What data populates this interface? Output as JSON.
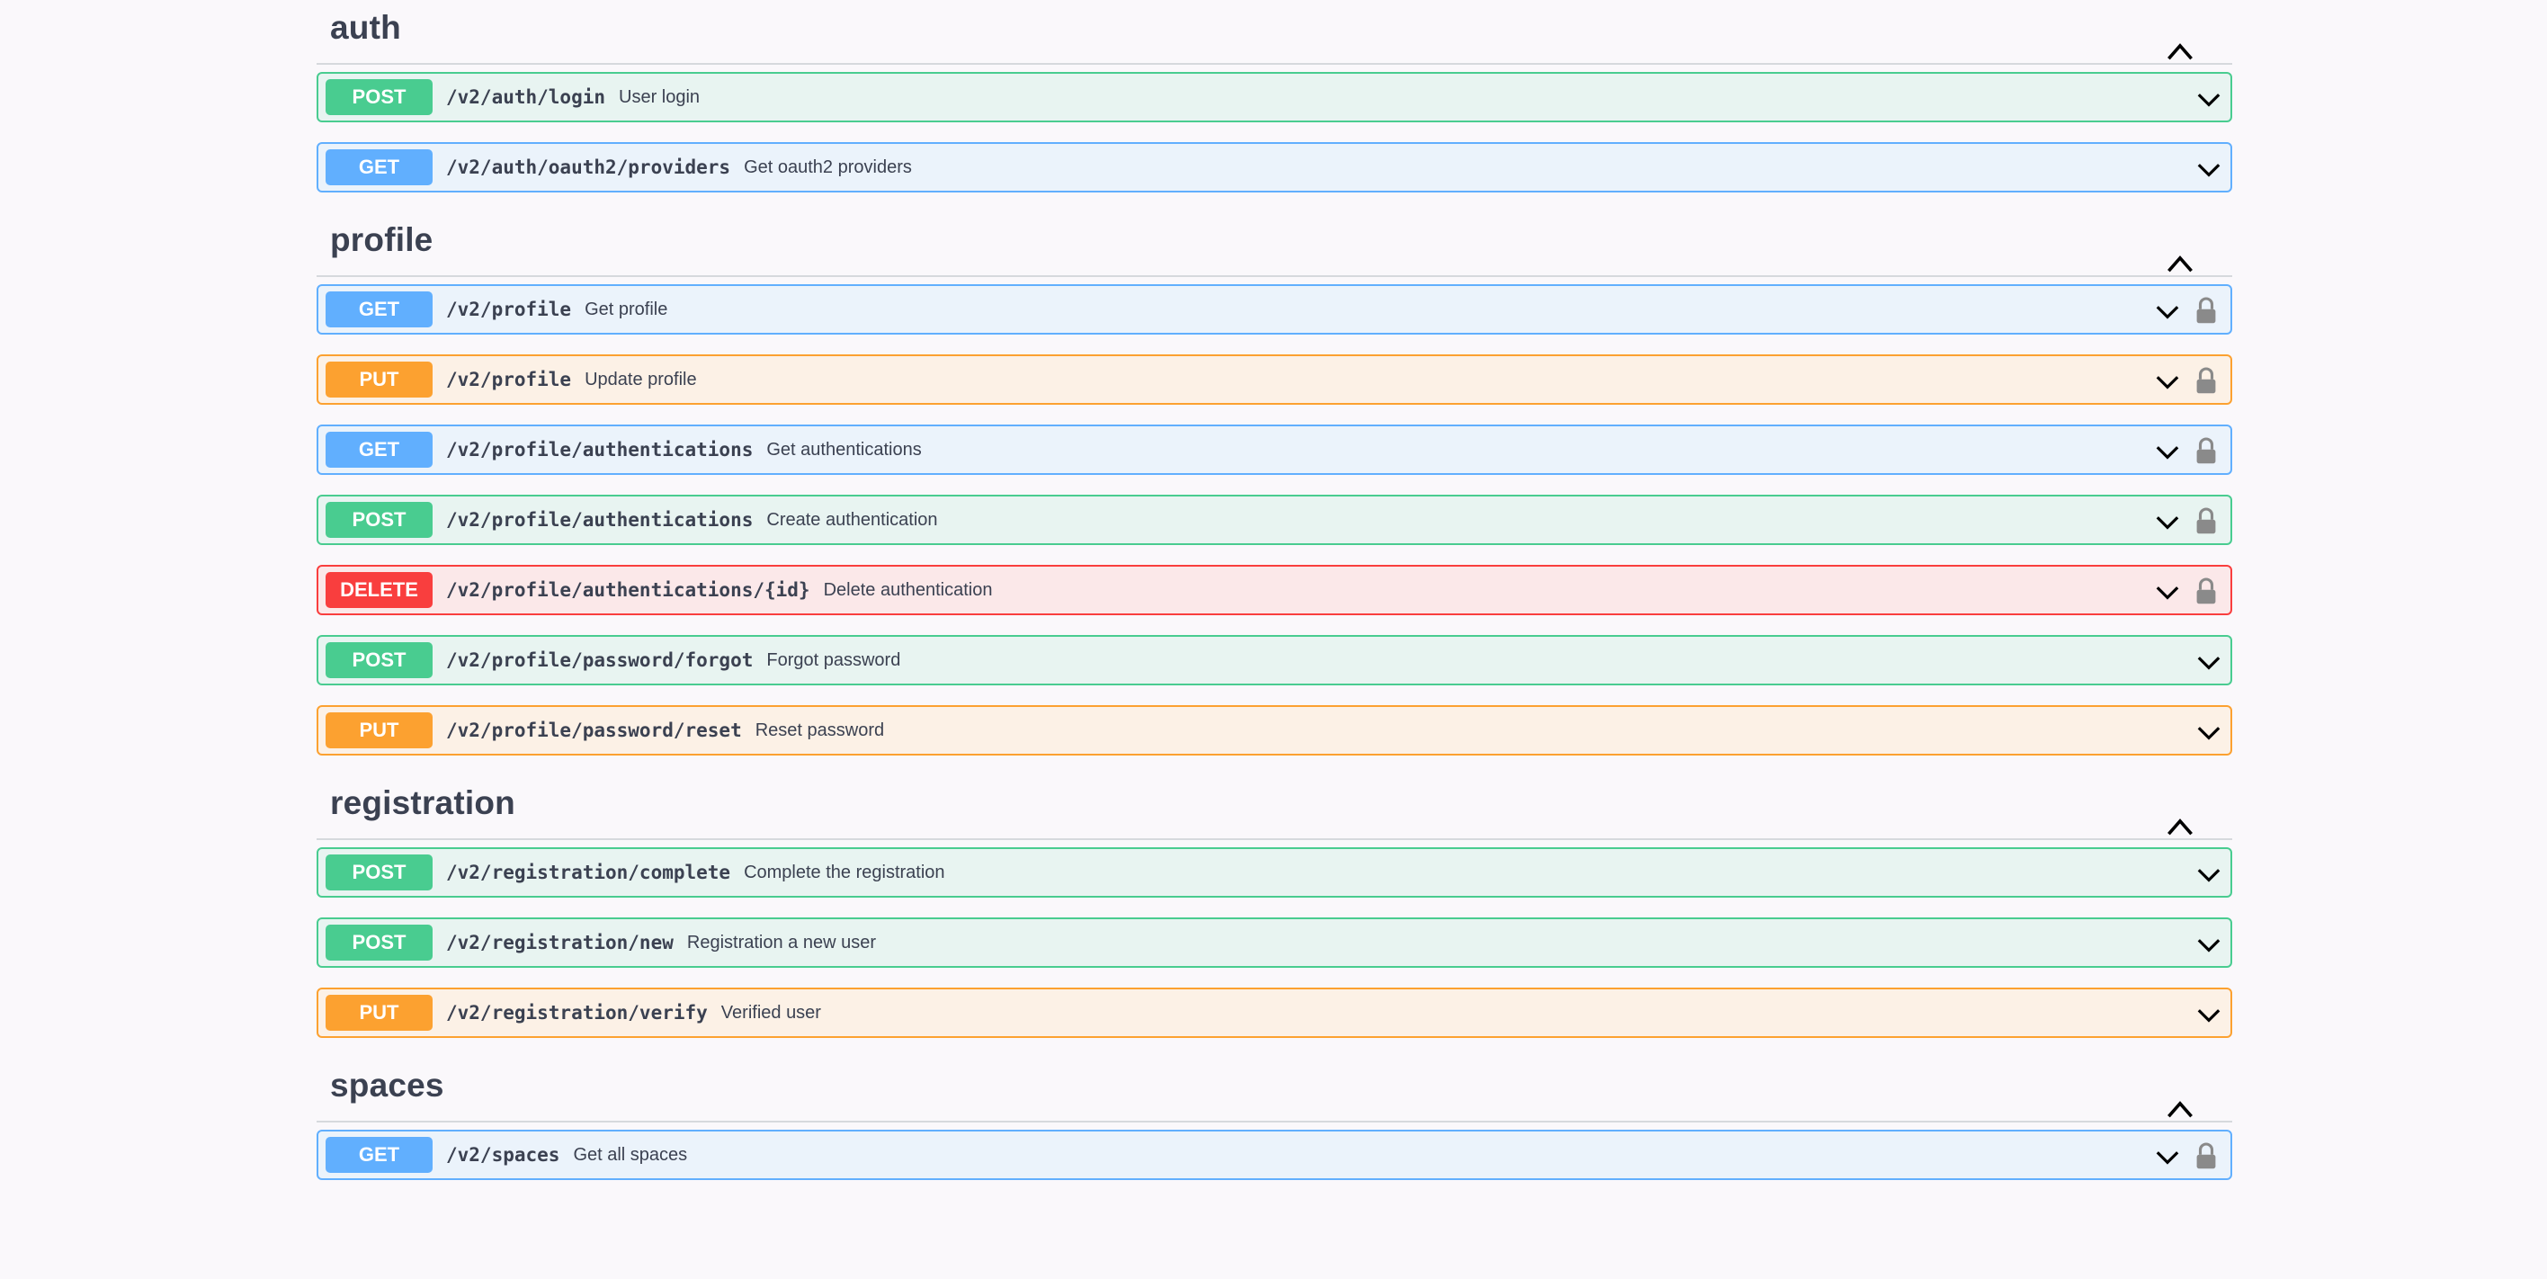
{
  "sections": [
    {
      "name": "auth",
      "operations": [
        {
          "method": "POST",
          "path": "/v2/auth/login",
          "summary": "User login",
          "locked": false
        },
        {
          "method": "GET",
          "path": "/v2/auth/oauth2/providers",
          "summary": "Get oauth2 providers",
          "locked": false
        }
      ]
    },
    {
      "name": "profile",
      "operations": [
        {
          "method": "GET",
          "path": "/v2/profile",
          "summary": "Get profile",
          "locked": true
        },
        {
          "method": "PUT",
          "path": "/v2/profile",
          "summary": "Update profile",
          "locked": true
        },
        {
          "method": "GET",
          "path": "/v2/profile/authentications",
          "summary": "Get authentications",
          "locked": true
        },
        {
          "method": "POST",
          "path": "/v2/profile/authentications",
          "summary": "Create authentication",
          "locked": true
        },
        {
          "method": "DELETE",
          "path": "/v2/profile/authentications/{id}",
          "summary": "Delete authentication",
          "locked": true
        },
        {
          "method": "POST",
          "path": "/v2/profile/password/forgot",
          "summary": "Forgot password",
          "locked": false
        },
        {
          "method": "PUT",
          "path": "/v2/profile/password/reset",
          "summary": "Reset password",
          "locked": false
        }
      ]
    },
    {
      "name": "registration",
      "operations": [
        {
          "method": "POST",
          "path": "/v2/registration/complete",
          "summary": "Complete the registration",
          "locked": false
        },
        {
          "method": "POST",
          "path": "/v2/registration/new",
          "summary": "Registration a new user",
          "locked": false
        },
        {
          "method": "PUT",
          "path": "/v2/registration/verify",
          "summary": "Verified user",
          "locked": false
        }
      ]
    },
    {
      "name": "spaces",
      "operations": [
        {
          "method": "GET",
          "path": "/v2/spaces",
          "summary": "Get all spaces",
          "locked": true
        }
      ]
    }
  ],
  "icons": {
    "section_toggle": "chevron-up-icon",
    "operation_expand": "chevron-down-icon",
    "authorization": "lock-icon"
  },
  "colors": {
    "post": "#49cc90",
    "get": "#61affe",
    "put": "#fca130",
    "delete": "#f93e3e",
    "text": "#3b4151",
    "background": "#faf8fb"
  }
}
